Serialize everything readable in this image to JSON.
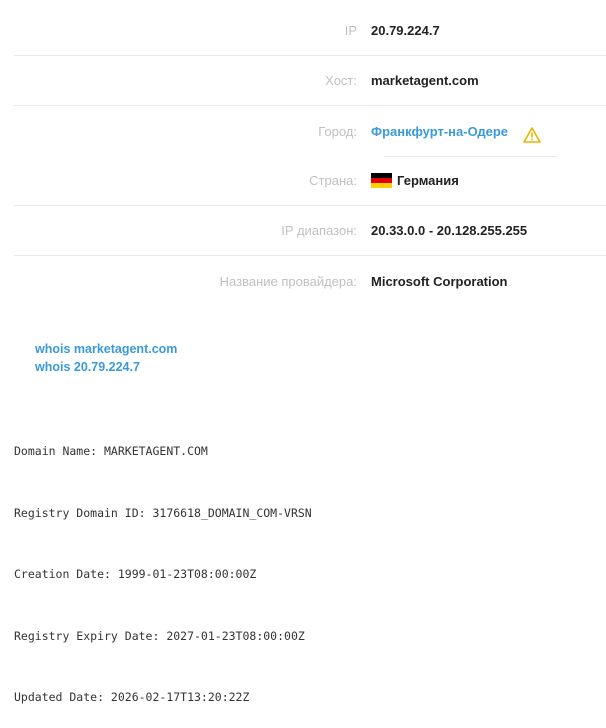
{
  "info": {
    "ip": {
      "label": "IP",
      "value": "20.79.224.7"
    },
    "host": {
      "label": "Хост:",
      "value": "marketagent.com"
    },
    "city": {
      "label": "Город:",
      "value": "Франкфурт-на-Одере"
    },
    "country": {
      "label": "Страна:",
      "value": "Германия"
    },
    "ip_range": {
      "label": "IP диапазон:",
      "value": "20.33.0.0 - 20.128.255.255"
    },
    "provider": {
      "label": "Название провайдера:",
      "value": "Microsoft Corporation"
    }
  },
  "whois": {
    "domain_link": "whois marketagent.com",
    "ip_link": "whois 20.79.224.7",
    "lines": [
      "Domain Name: MARKETAGENT.COM",
      "Registry Domain ID: 3176618_DOMAIN_COM-VRSN",
      "Creation Date: 1999-01-23T08:00:00Z",
      "Registry Expiry Date: 2027-01-23T08:00:00Z",
      "Updated Date: 2026-02-17T13:20:22Z"
    ]
  },
  "icons": {
    "warning": "warning-icon",
    "flag": "germany-flag-icon"
  },
  "colors": {
    "link": "#3a9ad9",
    "label": "#c0c0c0",
    "warning": "#e8b400"
  }
}
